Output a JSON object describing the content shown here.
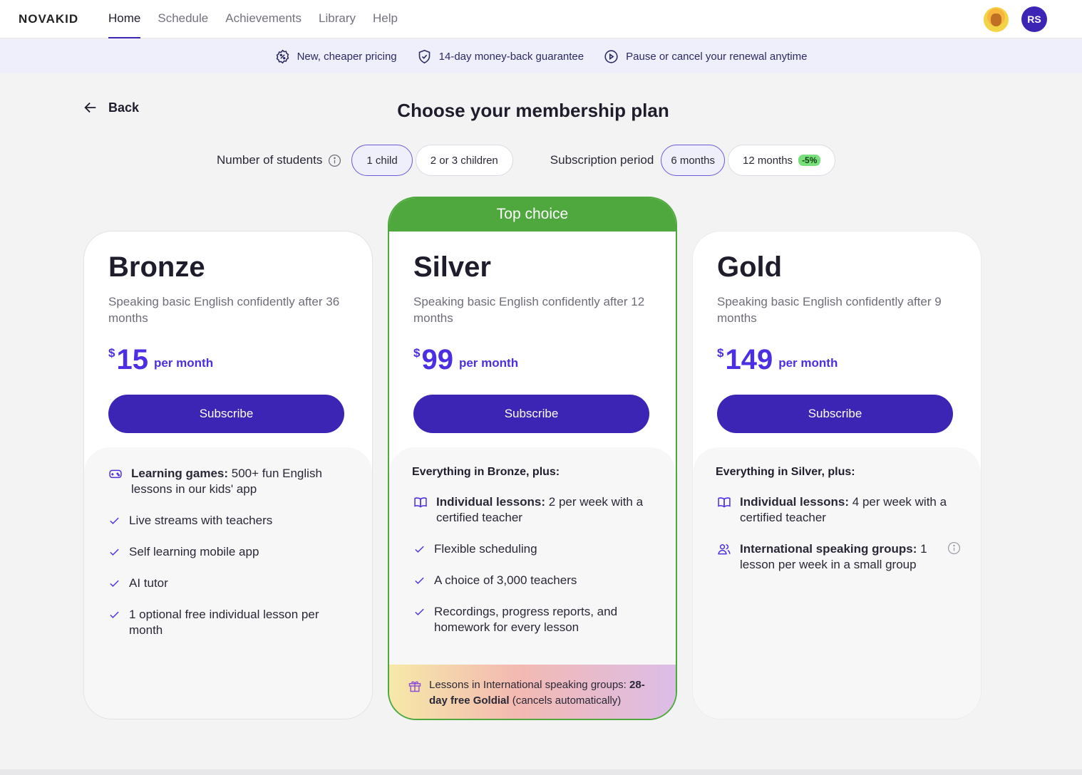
{
  "header": {
    "logo": "NOVAKID",
    "nav": [
      {
        "label": "Home",
        "active": true
      },
      {
        "label": "Schedule"
      },
      {
        "label": "Achievements"
      },
      {
        "label": "Library"
      },
      {
        "label": "Help"
      }
    ],
    "user_initials": "RS"
  },
  "benefits": [
    {
      "icon": "discount-badge-icon",
      "label": "New, cheaper pricing"
    },
    {
      "icon": "shield-check-icon",
      "label": "14-day money-back guarantee"
    },
    {
      "icon": "play-circle-icon",
      "label": "Pause or cancel your renewal anytime"
    }
  ],
  "back_label": "Back",
  "page_title": "Choose your membership plan",
  "filters": {
    "students_label": "Number of students",
    "students_options": [
      "1 child",
      "2 or 3 children"
    ],
    "students_selected": "1 child",
    "period_label": "Subscription period",
    "period_options": [
      "6 months",
      "12 months"
    ],
    "period_selected": "6 months",
    "period_discount": "-5%"
  },
  "plans": {
    "bronze": {
      "name": "Bronze",
      "desc": "Speaking basic English confidently after 36 months",
      "currency": "$",
      "price": "15",
      "per": "per month",
      "cta": "Subscribe",
      "features": [
        {
          "bold": "Learning games:",
          "text": " 500+ fun English lessons in our kids' app"
        },
        {
          "text": "Live streams with teachers"
        },
        {
          "text": "Self learning mobile app"
        },
        {
          "text": "AI tutor"
        },
        {
          "text": "1 optional free individual lesson per month"
        }
      ]
    },
    "silver": {
      "badge": "Top choice",
      "name": "Silver",
      "desc": "Speaking basic English confidently after 12 months",
      "currency": "$",
      "price": "99",
      "per": "per month",
      "cta": "Subscribe",
      "intro": "Everything in Bronze, plus:",
      "features": [
        {
          "bold": "Individual lessons:",
          "text": " 2 per week with a certified teacher"
        },
        {
          "text": "Flexible scheduling"
        },
        {
          "text": "A choice of 3,000 teachers"
        },
        {
          "text": "Recordings, progress reports, and homework for every lesson"
        }
      ],
      "promo": {
        "text1": "Lessons in International speaking groups: ",
        "bold": "28-day free Goldial",
        "text2": " (cancels automatically)"
      }
    },
    "gold": {
      "name": "Gold",
      "desc": "Speaking basic English confidently after 9 months",
      "currency": "$",
      "price": "149",
      "per": "per month",
      "cta": "Subscribe",
      "intro": "Everything in Silver, plus:",
      "features": [
        {
          "bold": "Individual lessons:",
          "text": " 4 per week with a certified teacher"
        },
        {
          "bold": "International speaking groups:",
          "text": " 1 lesson per week in a small group"
        }
      ]
    }
  },
  "colors": {
    "accent": "#3c24b4",
    "price": "#4b2fe3",
    "top_choice": "#4fa83d",
    "discount": "#77e07a"
  }
}
